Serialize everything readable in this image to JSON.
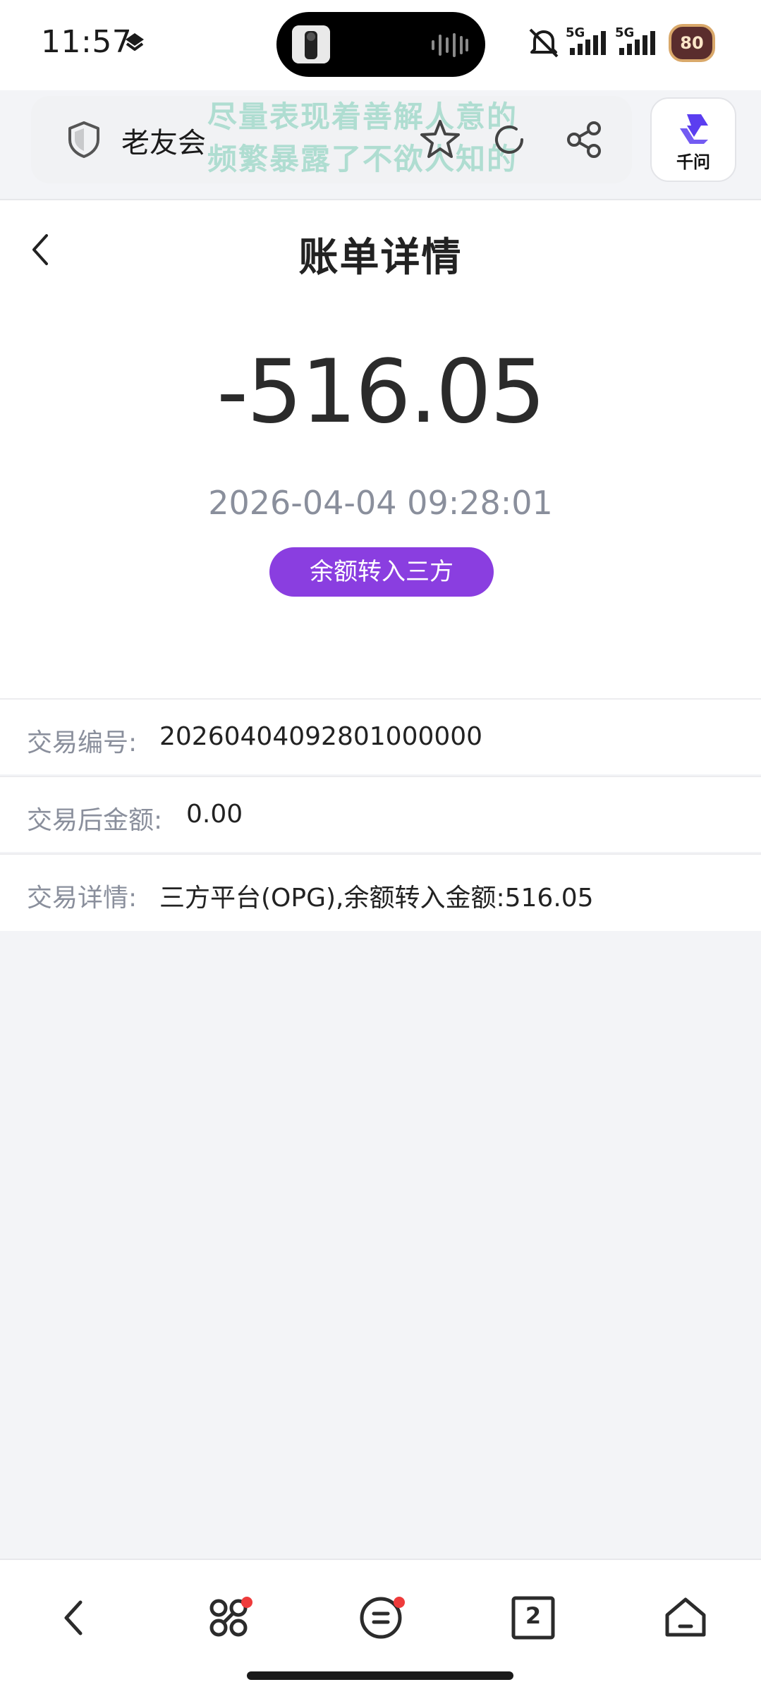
{
  "status_bar": {
    "time": "11:57",
    "net1": "5G",
    "net2": "5G",
    "battery": "80"
  },
  "browser": {
    "site_title": "老友会",
    "watermark_line1": "尽量表现着善解人意的",
    "watermark_line2": "频繁暴露了不欲人知的",
    "assistant_label": "千问",
    "tab_count": "2"
  },
  "header": {
    "title": "账单详情"
  },
  "bill": {
    "amount": "-516.05",
    "datetime": "2026-04-04 09:28:01",
    "type_badge": "余额转入三方"
  },
  "details": [
    {
      "label": "交易编号:",
      "value": "20260404092801000000"
    },
    {
      "label": "交易后金额:",
      "value": "0.00"
    },
    {
      "label": "交易详情:",
      "value": "三方平台(OPG),余额转入金额:516.05"
    }
  ],
  "colors": {
    "accent": "#8a3ee0",
    "background": "#f3f4f7",
    "badge_dot": "#ee3b3b"
  },
  "icons": {
    "back": "chevron-left-icon",
    "shield": "shield-icon",
    "star": "star-icon",
    "refresh": "refresh-icon",
    "share": "share-icon",
    "nav": [
      "back-arrow-icon",
      "ai-flower-icon",
      "menu-circle-icon",
      "tabs-icon",
      "home-icon"
    ]
  }
}
